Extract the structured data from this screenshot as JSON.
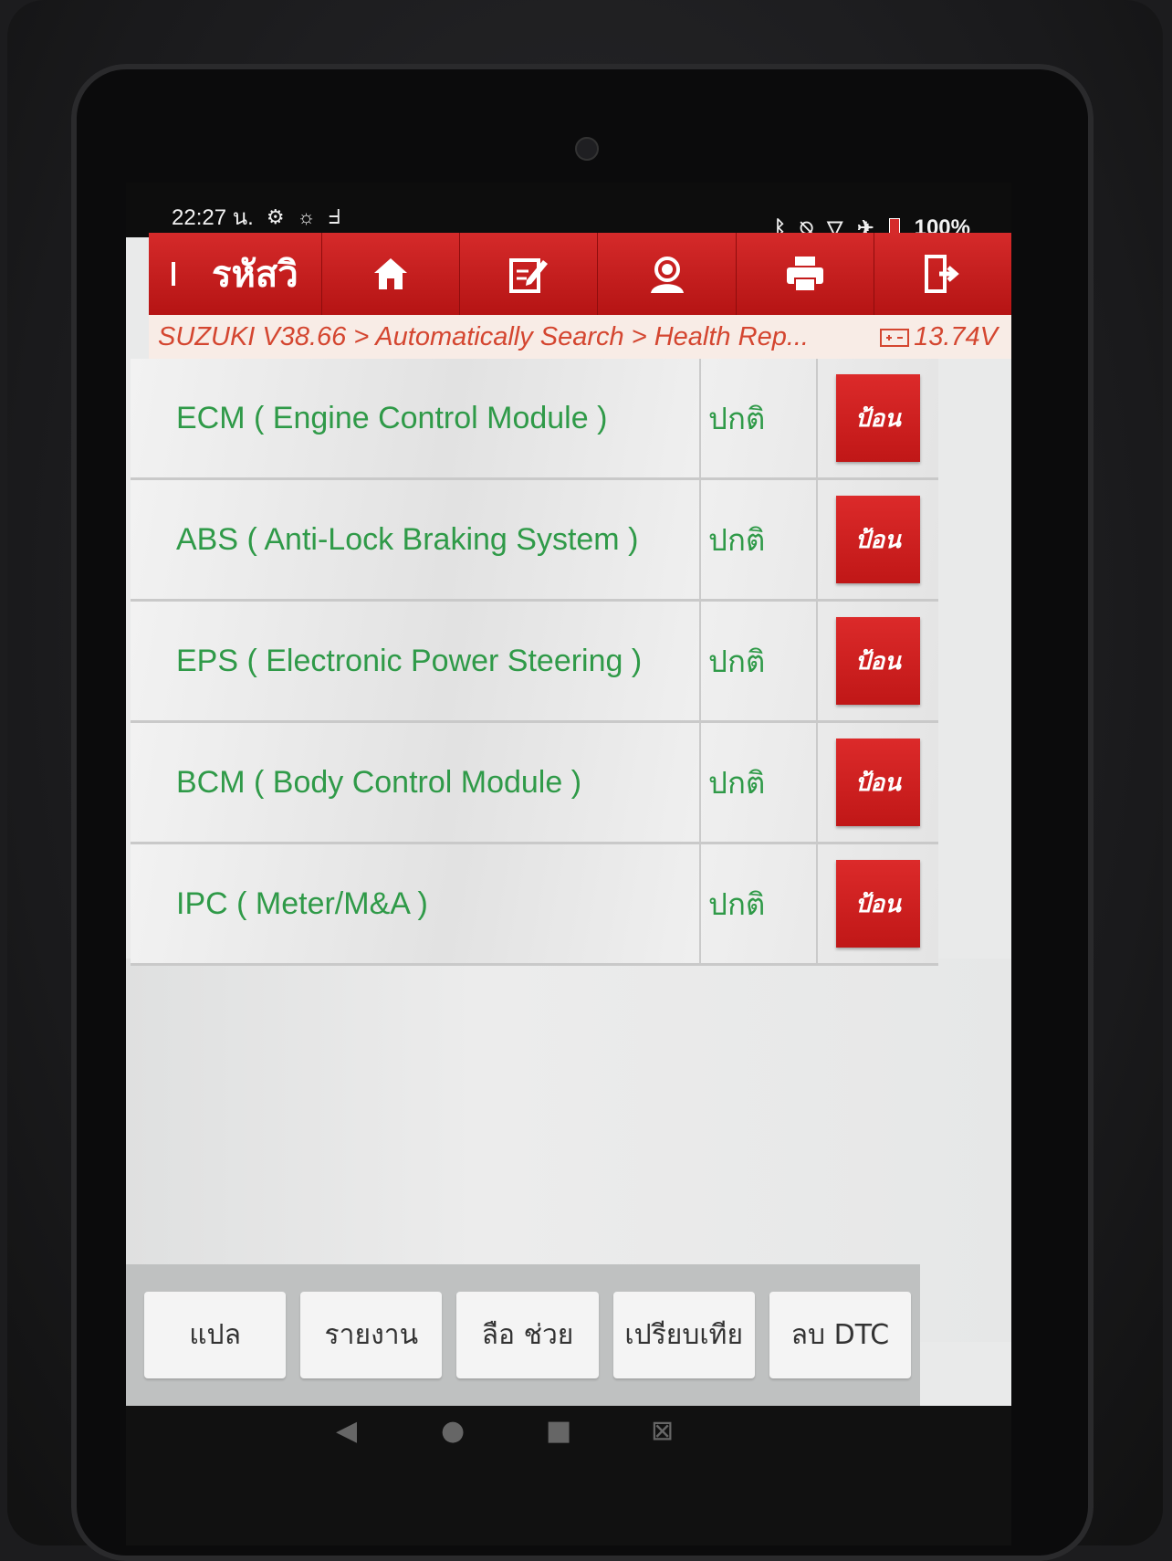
{
  "status_bar": {
    "time": "22:27 น.",
    "battery": "100%",
    "icons_left": [
      "gear-icon",
      "brightness-icon",
      "stethoscope-icon"
    ],
    "icons_right": [
      "bluetooth-icon",
      "mute-icon",
      "wifi-icon",
      "airplane-icon",
      "battery-icon"
    ]
  },
  "header": {
    "title": "รหัสวิ",
    "buttons": [
      "home-icon",
      "edit-icon",
      "support-icon",
      "print-icon",
      "exit-icon"
    ]
  },
  "breadcrumb": {
    "path": "SUZUKI V38.66 > Automatically Search > Health Rep...",
    "voltage": "13.74V"
  },
  "modules": [
    {
      "name": "ECM ( Engine Control Module )",
      "status": "ปกติ",
      "action": "ป้อน"
    },
    {
      "name": "ABS ( Anti-Lock Braking System )",
      "status": "ปกติ",
      "action": "ป้อน"
    },
    {
      "name": "EPS ( Electronic Power Steering )",
      "status": "ปกติ",
      "action": "ป้อน"
    },
    {
      "name": "BCM ( Body Control Module )",
      "status": "ปกติ",
      "action": "ป้อน"
    },
    {
      "name": "IPC ( Meter/M&A )",
      "status": "ปกติ",
      "action": "ป้อน"
    }
  ],
  "bottom_buttons": [
    "แปล",
    "รายงาน",
    "ลือ ช่วย",
    "เปรียบเทีย",
    "ลบ DTC"
  ],
  "colors": {
    "brand_red": "#c41a1a",
    "status_green": "#2f9a48",
    "crumb_text": "#d44630"
  }
}
